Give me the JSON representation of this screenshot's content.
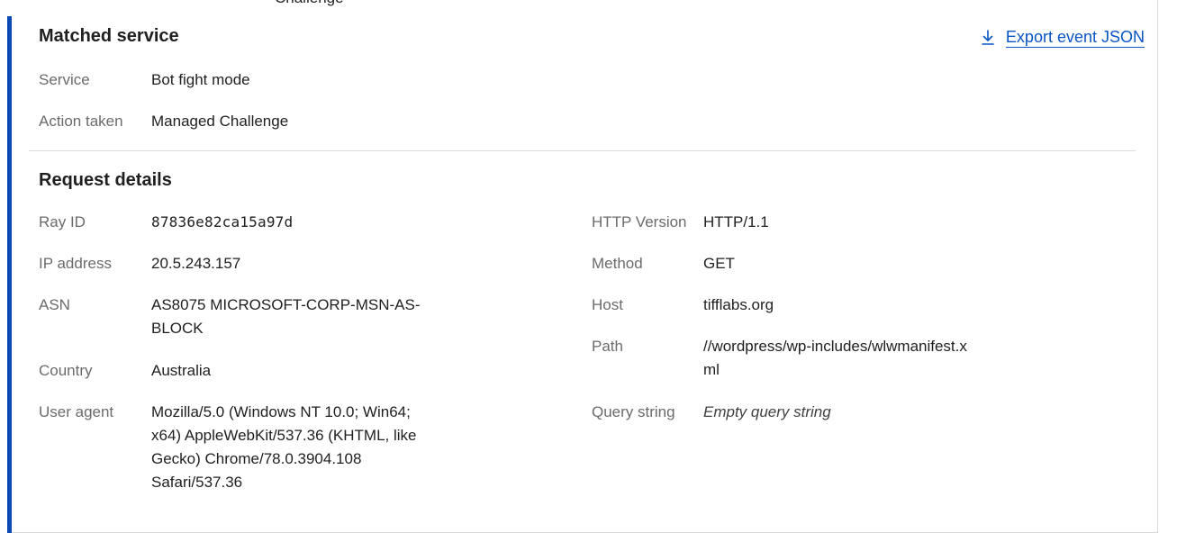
{
  "top_clip_text": "Challenge",
  "matched_service": {
    "title": "Matched service",
    "export_label": "Export event JSON",
    "fields": [
      {
        "label": "Service",
        "value": "Bot fight mode"
      },
      {
        "label": "Action taken",
        "value": "Managed Challenge"
      }
    ]
  },
  "request_details": {
    "title": "Request details",
    "left": [
      {
        "label": "Ray ID",
        "value": "87836e82ca15a97d"
      },
      {
        "label": "IP address",
        "value": "20.5.243.157"
      },
      {
        "label": "ASN",
        "value_lines": [
          "AS8075 MICROSOFT-CORP-MSN-AS-",
          "BLOCK"
        ]
      },
      {
        "label": "Country",
        "value": "Australia"
      },
      {
        "label": "User agent",
        "value_lines": [
          "Mozilla/5.0 (Windows NT 10.0; Win64;",
          "x64) AppleWebKit/537.36 (KHTML, like",
          "Gecko) Chrome/78.0.3904.108",
          "Safari/537.36"
        ]
      }
    ],
    "right": [
      {
        "label": "HTTP Version",
        "value": "HTTP/1.1"
      },
      {
        "label": "Method",
        "value": "GET"
      },
      {
        "label": "Host",
        "value": "tifflabs.org"
      },
      {
        "label": "Path",
        "value_lines": [
          "//wordpress/wp-includes/wlwmanifest.x",
          "ml"
        ]
      },
      {
        "label": "Query string",
        "value": "Empty query string"
      }
    ]
  },
  "icons": {
    "export": "download-icon"
  },
  "colors": {
    "accent": "#0a4ab2",
    "link": "#0a55c5"
  }
}
